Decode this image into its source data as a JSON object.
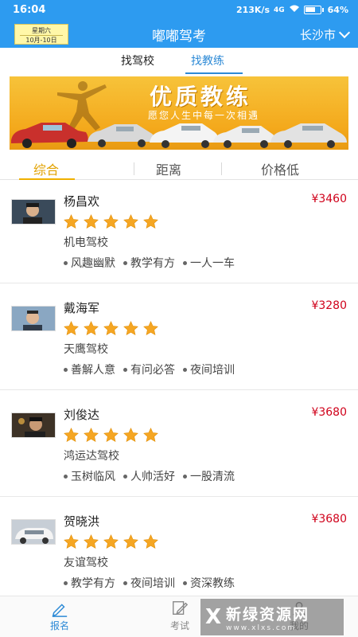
{
  "status_bar": {
    "time": "16:04",
    "network_speed": "213K/s",
    "signal": "4G",
    "battery": "64"
  },
  "header": {
    "calendar_day": "星期六",
    "calendar_date": "10月-10日",
    "title": "嘟嘟驾考",
    "city": "长沙市"
  },
  "search_tabs": [
    {
      "label": "找驾校",
      "active": false
    },
    {
      "label": "找教练",
      "active": true
    }
  ],
  "banner": {
    "title": "优质教练",
    "subtitle": "愿您人生中每一次相遇"
  },
  "sort_tabs": [
    {
      "label": "综合",
      "active": true
    },
    {
      "label": "距离",
      "active": false
    },
    {
      "label": "价格低",
      "active": false
    }
  ],
  "coaches": [
    {
      "name": "杨昌欢",
      "price": "¥3460",
      "rating": 5,
      "school": "机电驾校",
      "tags": [
        "风趣幽默",
        "教学有方",
        "一人一车"
      ]
    },
    {
      "name": "戴海军",
      "price": "¥3280",
      "rating": 5,
      "school": "天鹰驾校",
      "tags": [
        "善解人意",
        "有问必答",
        "夜间培训"
      ]
    },
    {
      "name": "刘俊达",
      "price": "¥3680",
      "rating": 5,
      "school": "鸿运达驾校",
      "tags": [
        "玉树临风",
        "人帅活好",
        "一股清流"
      ]
    },
    {
      "name": "贺晓洪",
      "price": "¥3680",
      "rating": 5,
      "school": "友谊驾校",
      "tags": [
        "教学有方",
        "夜间培训",
        "资深教练"
      ]
    }
  ],
  "bottom_nav": [
    {
      "label": "报名",
      "icon": "pencil-icon",
      "active": true
    },
    {
      "label": "考试",
      "icon": "exam-edit-icon",
      "active": false
    },
    {
      "label": "我的",
      "icon": "user-icon",
      "active": false
    }
  ],
  "watermark": {
    "logo": "X",
    "name": "新绿资源网",
    "url": "www.xlxs.com"
  },
  "colors": {
    "header_blue": "#2d9bf0",
    "active_tab_blue": "#2d8ad6",
    "sort_active": "#e2a200",
    "price_red": "#d0021b",
    "star_gold": "#f5a623"
  }
}
